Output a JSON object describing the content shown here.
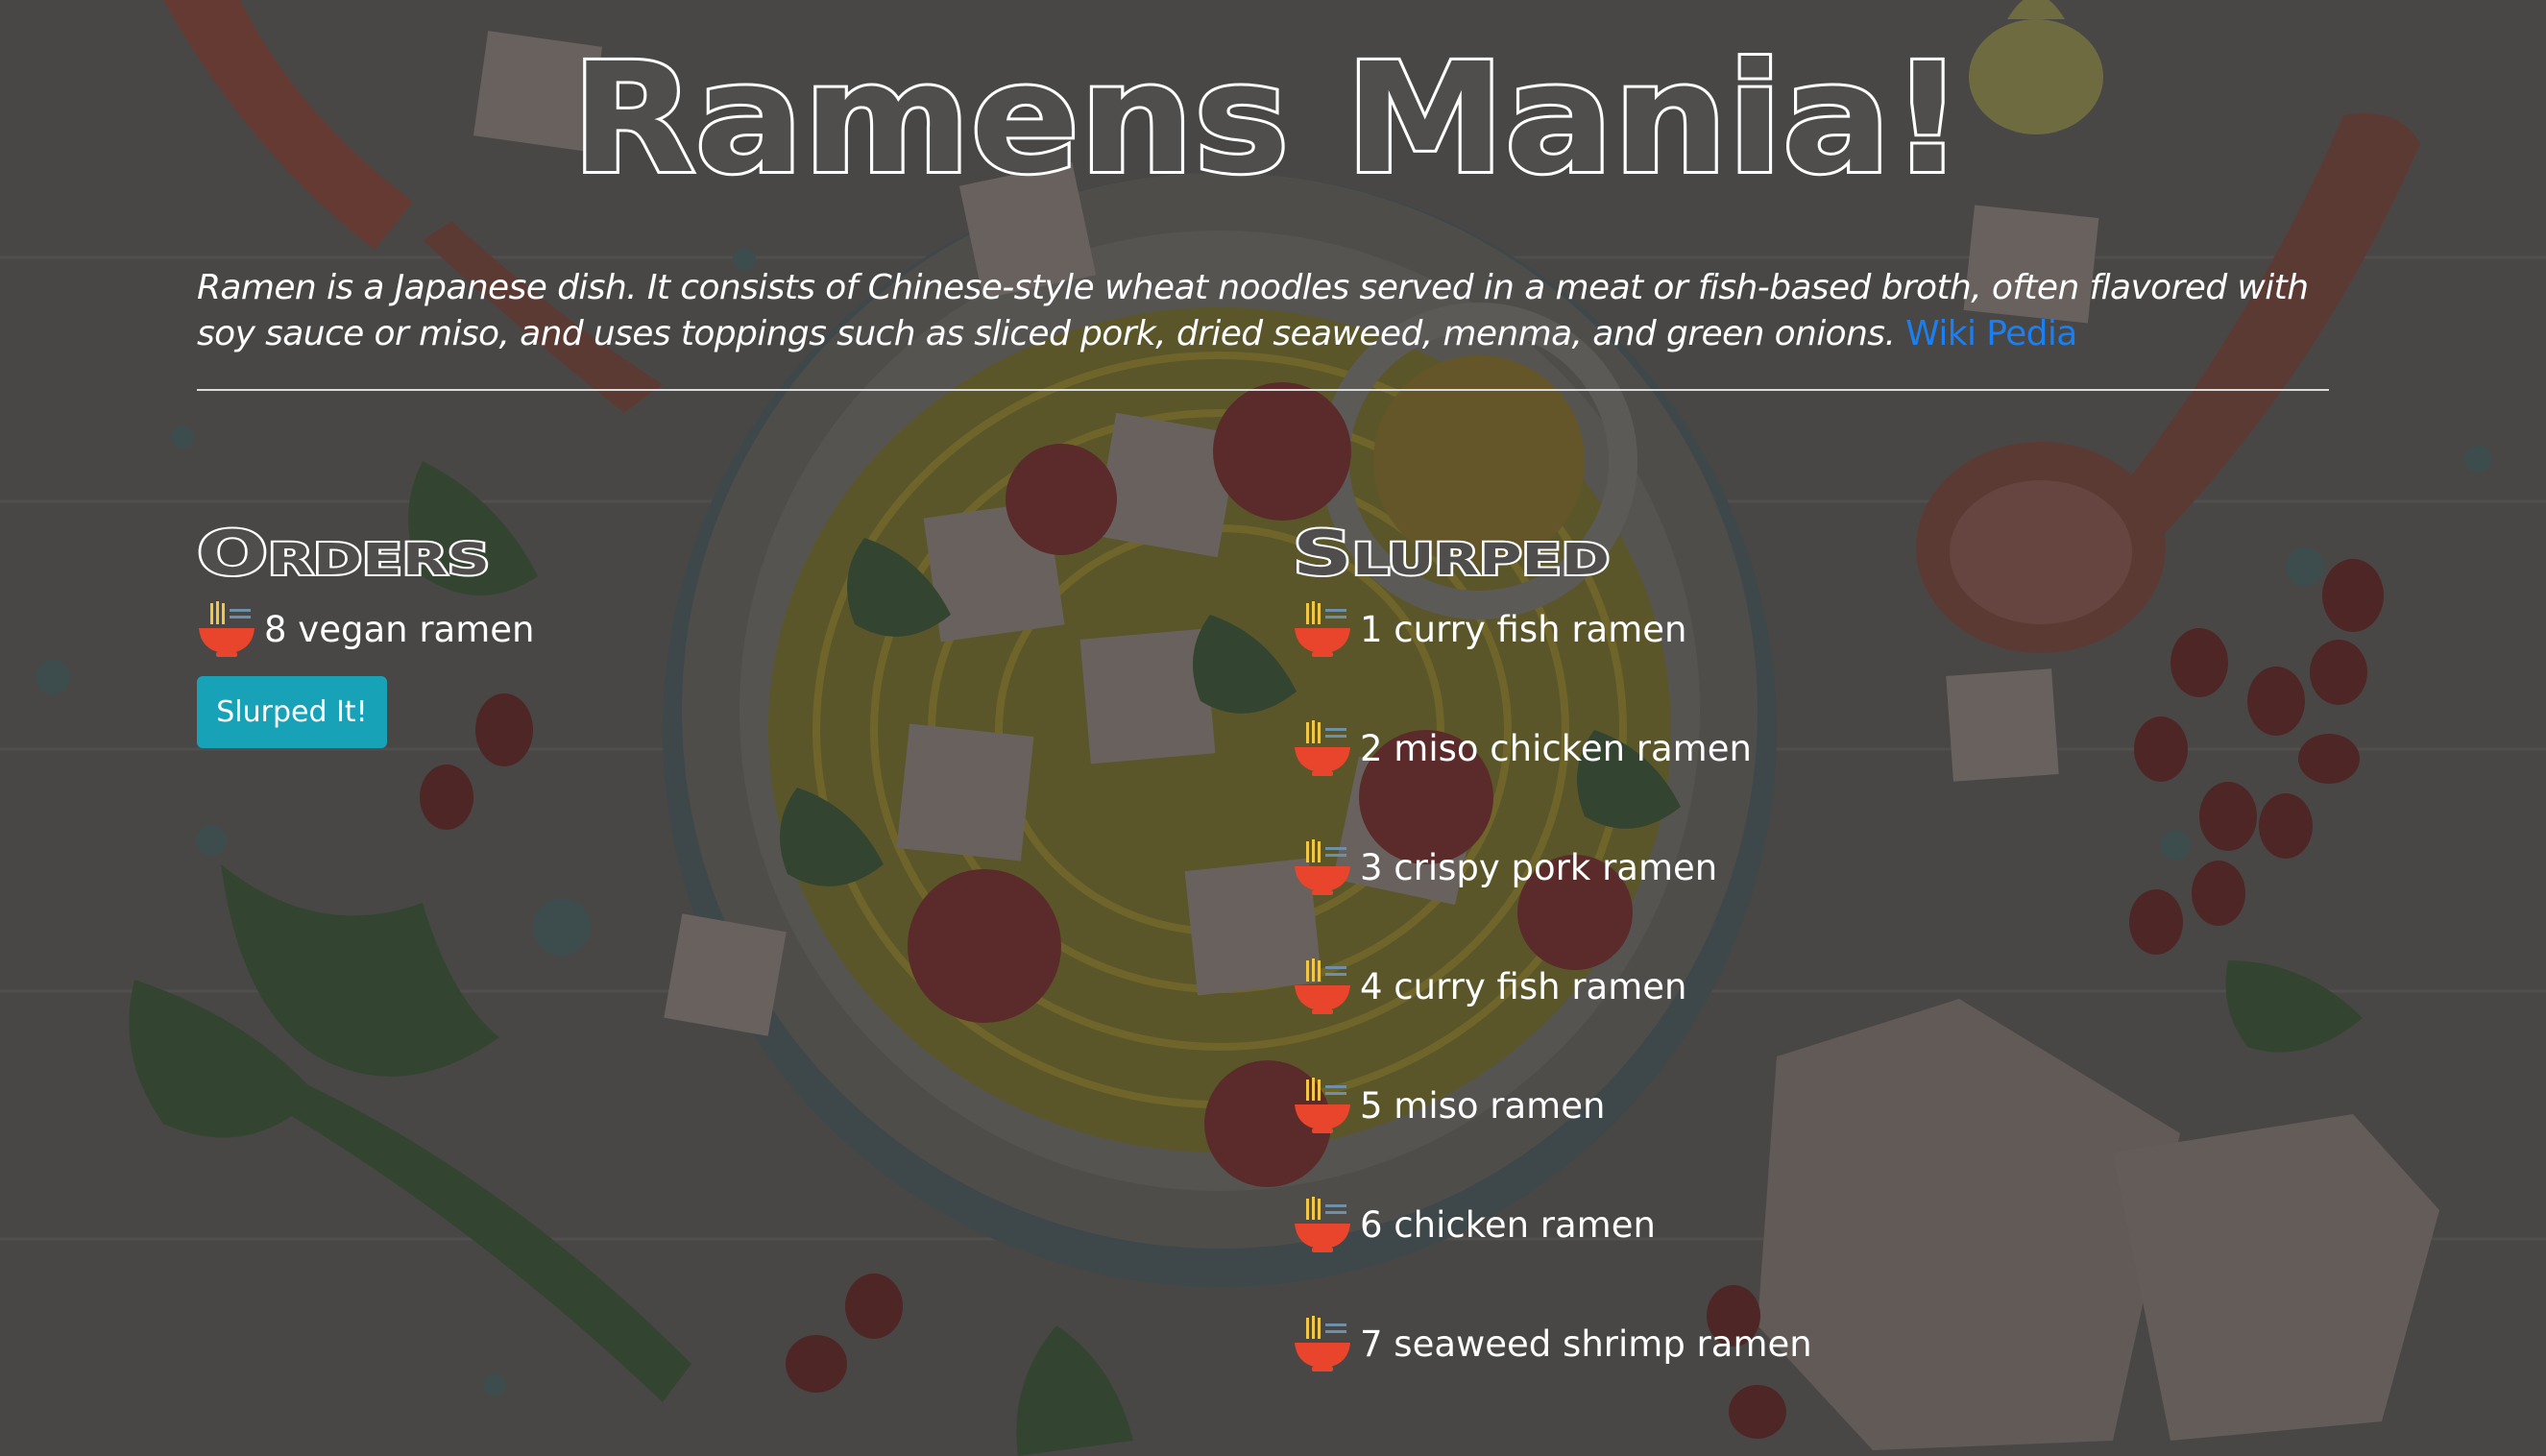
{
  "header": {
    "title": "Ramens Mania!"
  },
  "intro": {
    "text": "Ramen is a Japanese dish. It consists of Chinese-style wheat noodles served in a meat or fish-based broth, often flavored with soy sauce or miso, and uses toppings such as sliced pork, dried seaweed, menma, and green onions.",
    "link_label": "Wiki Pedia"
  },
  "orders": {
    "heading": "Orders",
    "items": [
      {
        "label": "8 vegan ramen",
        "icon": "ramen-bowl-icon"
      }
    ],
    "button_label": "Slurped It!"
  },
  "slurped": {
    "heading": "Slurped",
    "items": [
      {
        "label": "1 curry fish ramen",
        "icon": "ramen-bowl-icon"
      },
      {
        "label": "2 miso chicken ramen",
        "icon": "ramen-bowl-icon"
      },
      {
        "label": "3 crispy pork ramen",
        "icon": "ramen-bowl-icon"
      },
      {
        "label": "4 curry fish ramen",
        "icon": "ramen-bowl-icon"
      },
      {
        "label": "5 miso ramen",
        "icon": "ramen-bowl-icon"
      },
      {
        "label": "6 chicken ramen",
        "icon": "ramen-bowl-icon"
      },
      {
        "label": "7 seaweed shrimp ramen",
        "icon": "ramen-bowl-icon"
      }
    ]
  },
  "colors": {
    "background": "#4f4e4c",
    "link": "#1a7ff0",
    "button": "#17a2b8",
    "bowl": "#e8452c"
  }
}
